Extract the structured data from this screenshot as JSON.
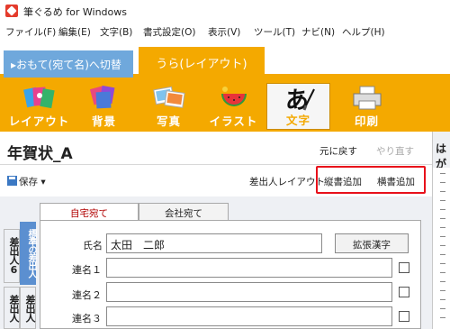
{
  "window": {
    "title": "筆ぐるめ for Windows"
  },
  "menu": [
    "ファイル(F)",
    "編集(E)",
    "文字(B)",
    "書式設定(O)",
    "表示(V)",
    "ツール(T)",
    "ナビ(N)",
    "ヘルプ(H)"
  ],
  "mode_tabs": {
    "front": "▸おもて(宛て名)へ切替",
    "back": "うら(レイアウト)"
  },
  "tools": [
    "レイアウト",
    "背景",
    "写真",
    "イラスト",
    "文字",
    "印刷"
  ],
  "selected_tool": "文字",
  "header": {
    "title": "年賀状_A",
    "undo": "元に戻す",
    "redo": "やり直す",
    "right_label": "はが"
  },
  "actions": {
    "save": "保存 ▾",
    "sender_layout": "差出人レイアウト",
    "vert_add": "縦書追加",
    "horz_add": "横書追加"
  },
  "address_tabs": {
    "home": "自宅宛て",
    "work": "会社宛て"
  },
  "side_tabs": [
    "差出人6",
    "標準の差出人",
    "差出人",
    "差出人"
  ],
  "fields": {
    "name_label": "氏名",
    "name_value": "太田　二郎",
    "ext_kanji": "拡張漢字",
    "renmei": [
      "連名１",
      "連名２",
      "連名３"
    ]
  },
  "colors": {
    "accent": "#f4a900",
    "front_tab": "#6fa8dc",
    "highlight": "#e8101a"
  }
}
